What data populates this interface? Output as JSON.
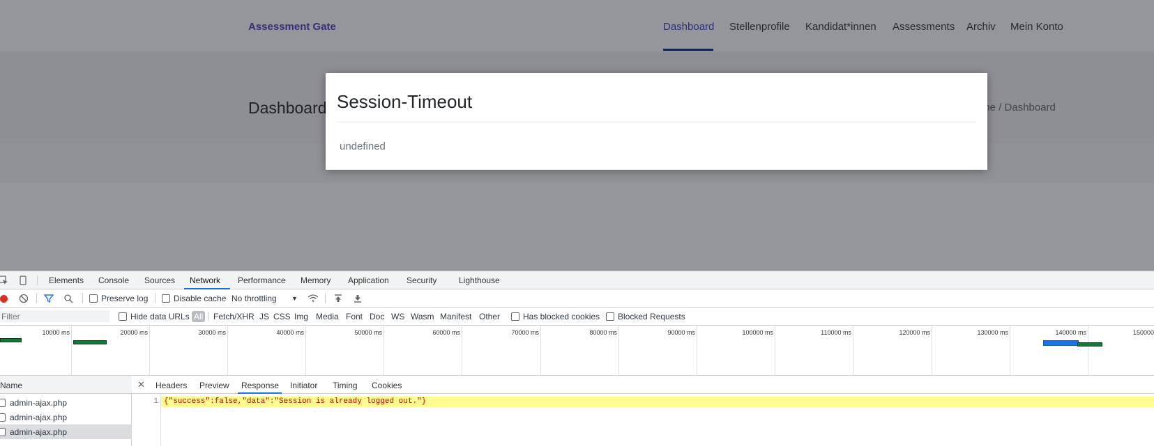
{
  "site": {
    "brand": "Assessment Gate",
    "nav": [
      "Dashboard",
      "Stellenprofile",
      "Kandidat*innen",
      "Assessments",
      "Archiv",
      "Mein Konto"
    ],
    "active_nav": "Dashboard",
    "page_title": "Dashboard",
    "breadcrumb": "Home / Dashboard"
  },
  "modal": {
    "title": "Session-Timeout",
    "body": "undefined"
  },
  "devtools": {
    "tabs": [
      "Elements",
      "Console",
      "Sources",
      "Network",
      "Performance",
      "Memory",
      "Application",
      "Security",
      "Lighthouse"
    ],
    "active_tab": "Network",
    "toolbar": {
      "preserve_log": "Preserve log",
      "disable_cache": "Disable cache",
      "throttling": "No throttling"
    },
    "filterbar": {
      "filter_placeholder": "Filter",
      "hide_data_urls": "Hide data URLs",
      "types": [
        "All",
        "Fetch/XHR",
        "JS",
        "CSS",
        "Img",
        "Media",
        "Font",
        "Doc",
        "WS",
        "Wasm",
        "Manifest",
        "Other"
      ],
      "has_blocked_cookies": "Has blocked cookies",
      "blocked_requests": "Blocked Requests"
    },
    "timeline_ticks": [
      "10000 ms",
      "20000 ms",
      "30000 ms",
      "40000 ms",
      "50000 ms",
      "60000 ms",
      "70000 ms",
      "80000 ms",
      "90000 ms",
      "100000 ms",
      "110000 ms",
      "120000 ms",
      "130000 ms",
      "140000 ms",
      "150000"
    ],
    "name_header": "Name",
    "requests": [
      "admin-ajax.php",
      "admin-ajax.php",
      "admin-ajax.php"
    ],
    "detail_tabs": [
      "Headers",
      "Preview",
      "Response",
      "Initiator",
      "Timing",
      "Cookies"
    ],
    "active_detail_tab": "Response",
    "response": {
      "line_number": "1",
      "text": "{\"success\":false,\"data\":\"Session is already logged out.\"}"
    }
  },
  "colors": {
    "brand": "#4a3fb8",
    "accent_blue": "#1a73e8",
    "record_red": "#d93025",
    "response_highlight": "#fffb8f"
  }
}
